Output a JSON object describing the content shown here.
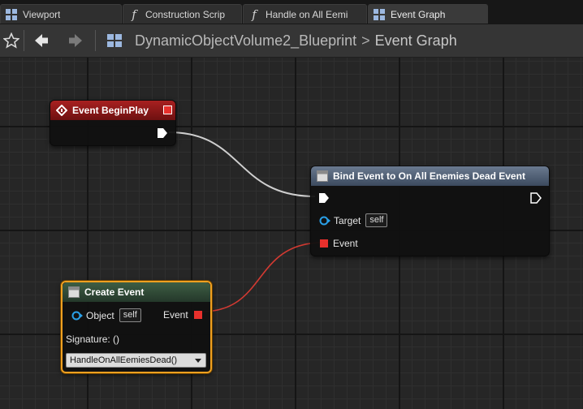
{
  "tabs": [
    {
      "label": "Viewport",
      "icon": "viewport-grid-icon",
      "active": false
    },
    {
      "label": "Construction Scrip",
      "icon": "function-icon",
      "active": false
    },
    {
      "label": "Handle on All Eemi",
      "icon": "function-icon",
      "active": false
    },
    {
      "label": "Event Graph",
      "icon": "graph-grid-icon",
      "active": true
    }
  ],
  "toolbar": {
    "breadcrumb_blueprint": "DynamicObjectVolume2_Blueprint",
    "breadcrumb_separator": ">",
    "breadcrumb_graph": "Event Graph"
  },
  "nodes": {
    "begin_play": {
      "title": "Event BeginPlay"
    },
    "bind_event": {
      "title": "Bind Event to On All Enemies Dead Event",
      "target_label": "Target",
      "target_value": "self",
      "event_label": "Event"
    },
    "create_event": {
      "title": "Create Event",
      "object_label": "Object",
      "object_value": "self",
      "event_label": "Event",
      "signature": "Signature: ()",
      "function_selected": "HandleOnAllEemiesDead()"
    }
  },
  "colors": {
    "event_header": "#8a1818",
    "function_header": "#4a5a70",
    "create_header": "#2f4a34",
    "delegate_pin": "#e8302c",
    "object_pin": "#2aa0e8",
    "exec_pin": "#ffffff",
    "selection": "#f0a020"
  }
}
